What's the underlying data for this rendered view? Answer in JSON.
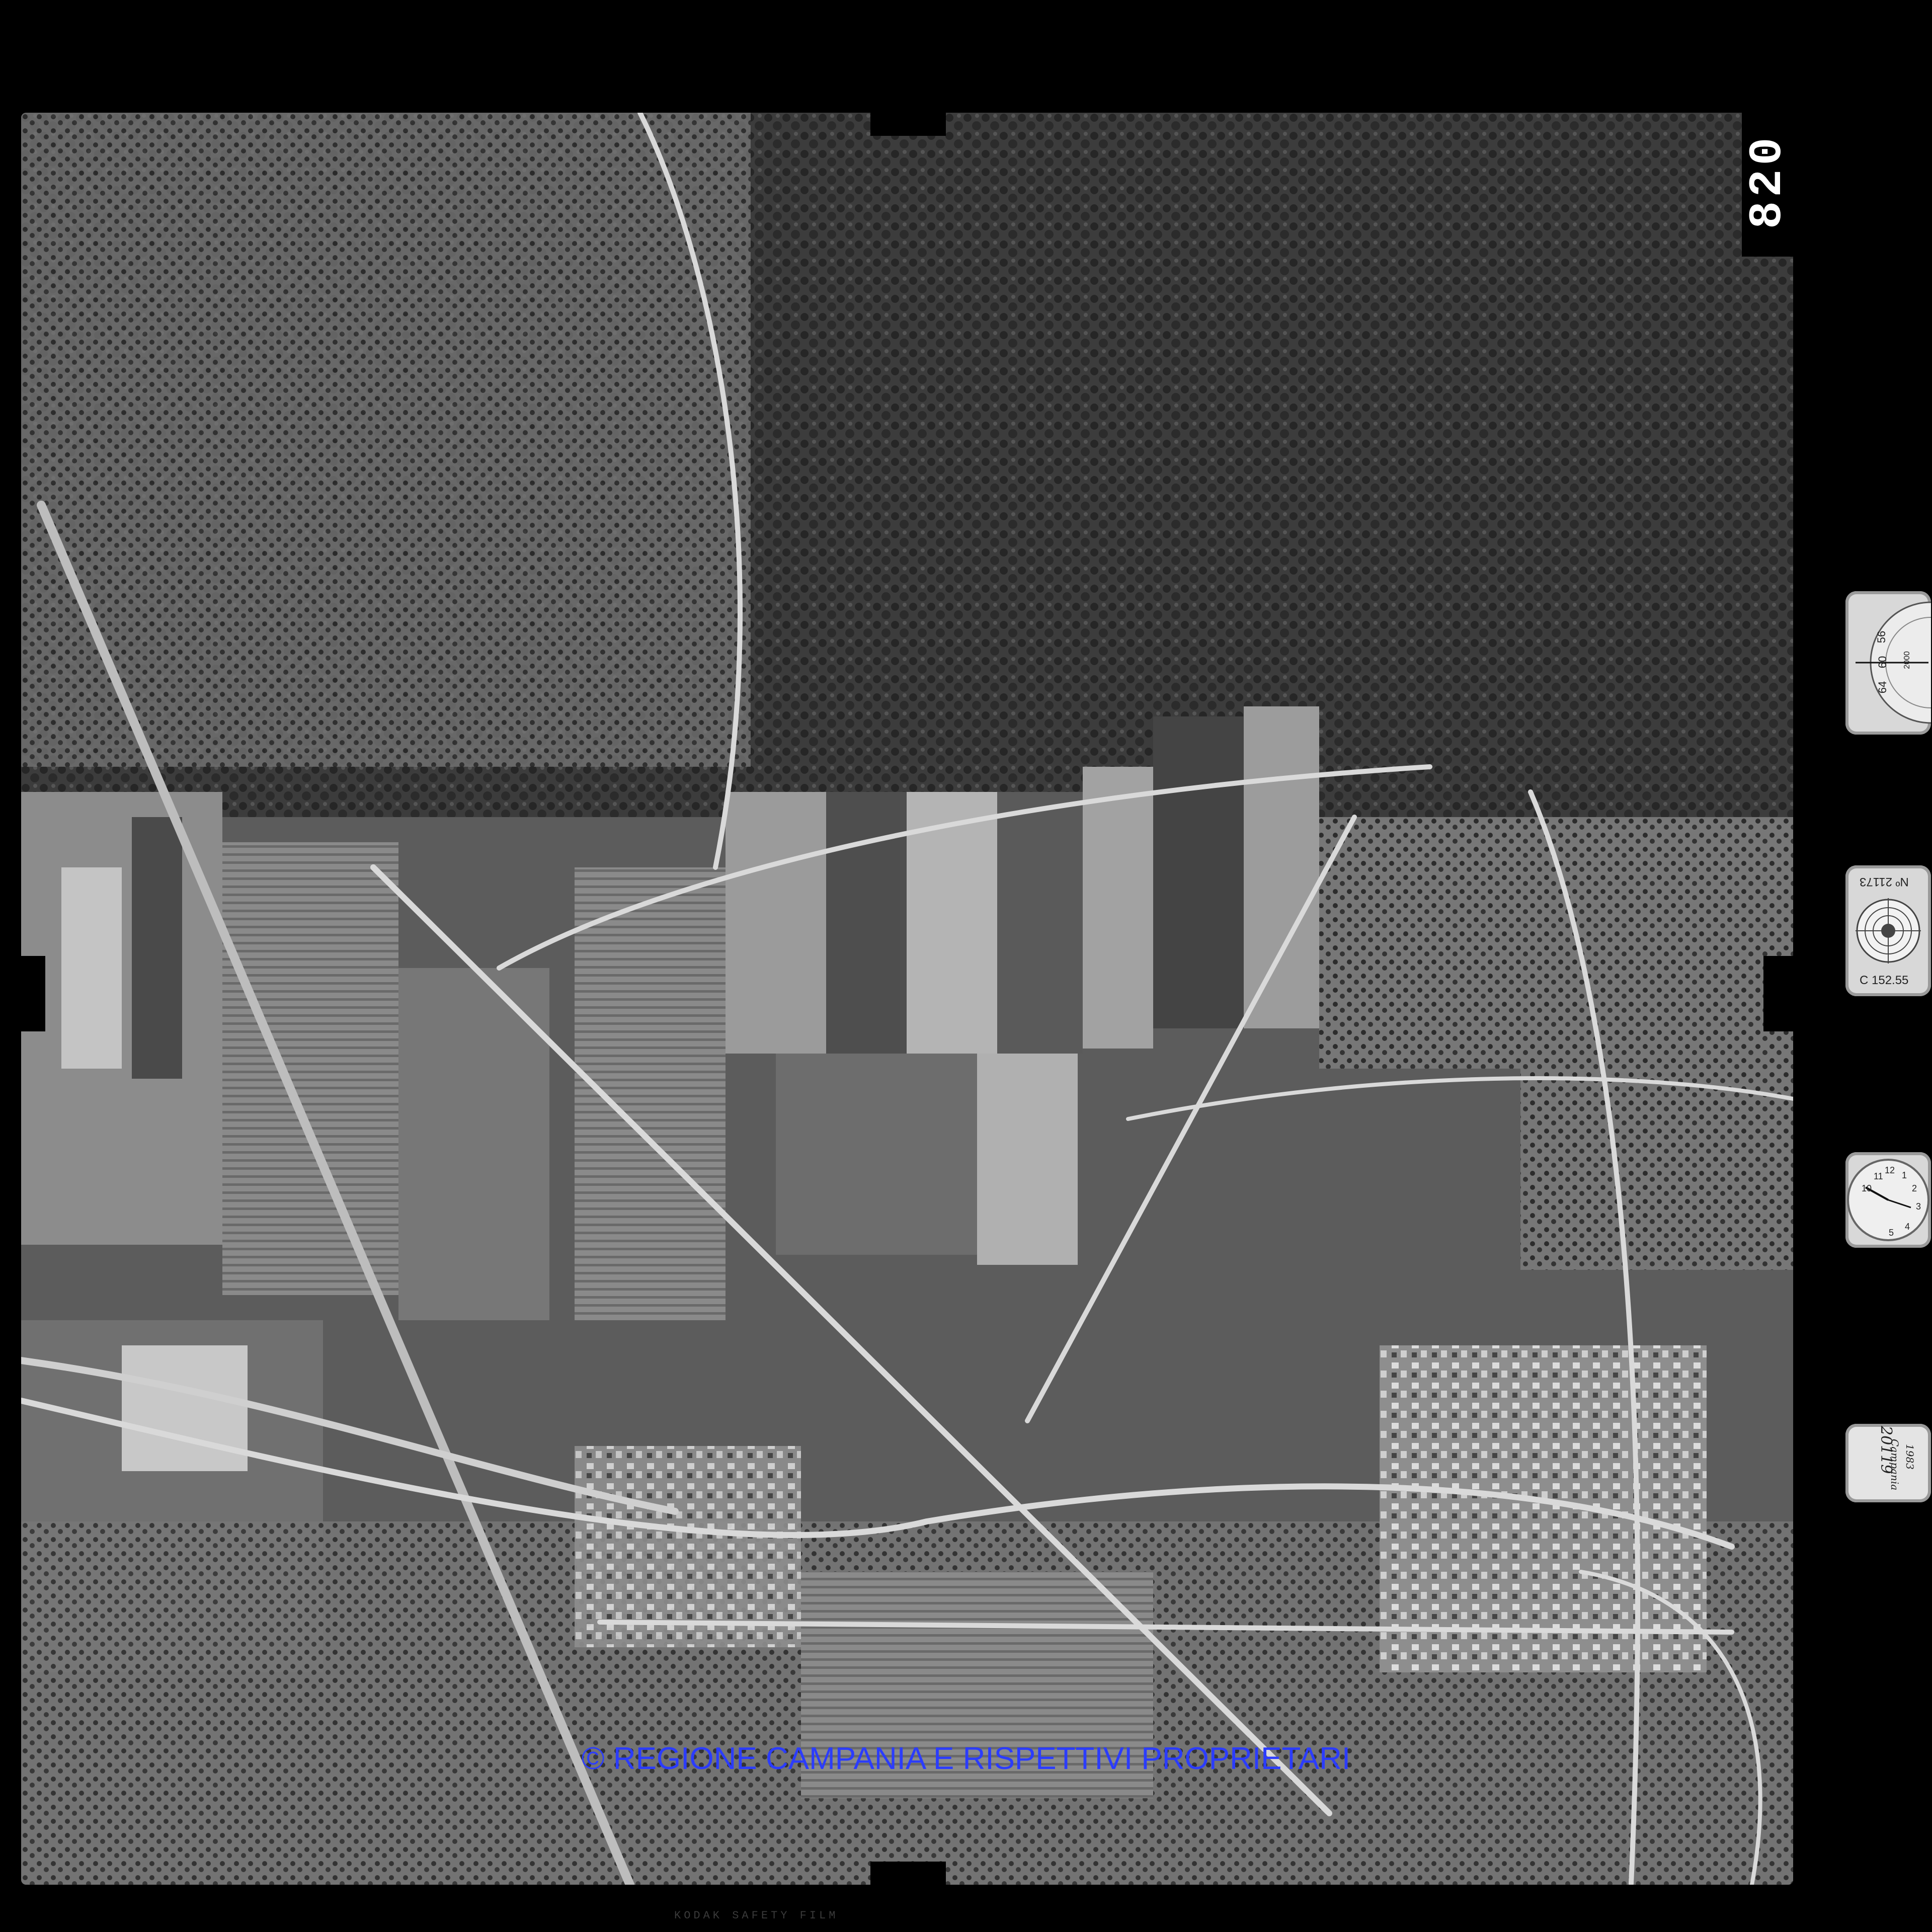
{
  "frame": {
    "number": "820"
  },
  "instruments": {
    "altimeter": {
      "scale_labels": [
        "56",
        "60",
        "64",
        "2000"
      ]
    },
    "level_bubble": {
      "serial": "Nº 21173",
      "focal": "C 152.55"
    },
    "clock": {
      "numerals": [
        "10",
        "11",
        "12",
        "1",
        "2",
        "3",
        "4",
        "5"
      ]
    },
    "note": {
      "line1": "20119",
      "line2": "Campania",
      "line3": "1983"
    }
  },
  "watermark": "© REGIONE CAMPANIA E RISPETTIVI PROPRIETARI",
  "edge_print": "KODAK SAFETY FILM"
}
